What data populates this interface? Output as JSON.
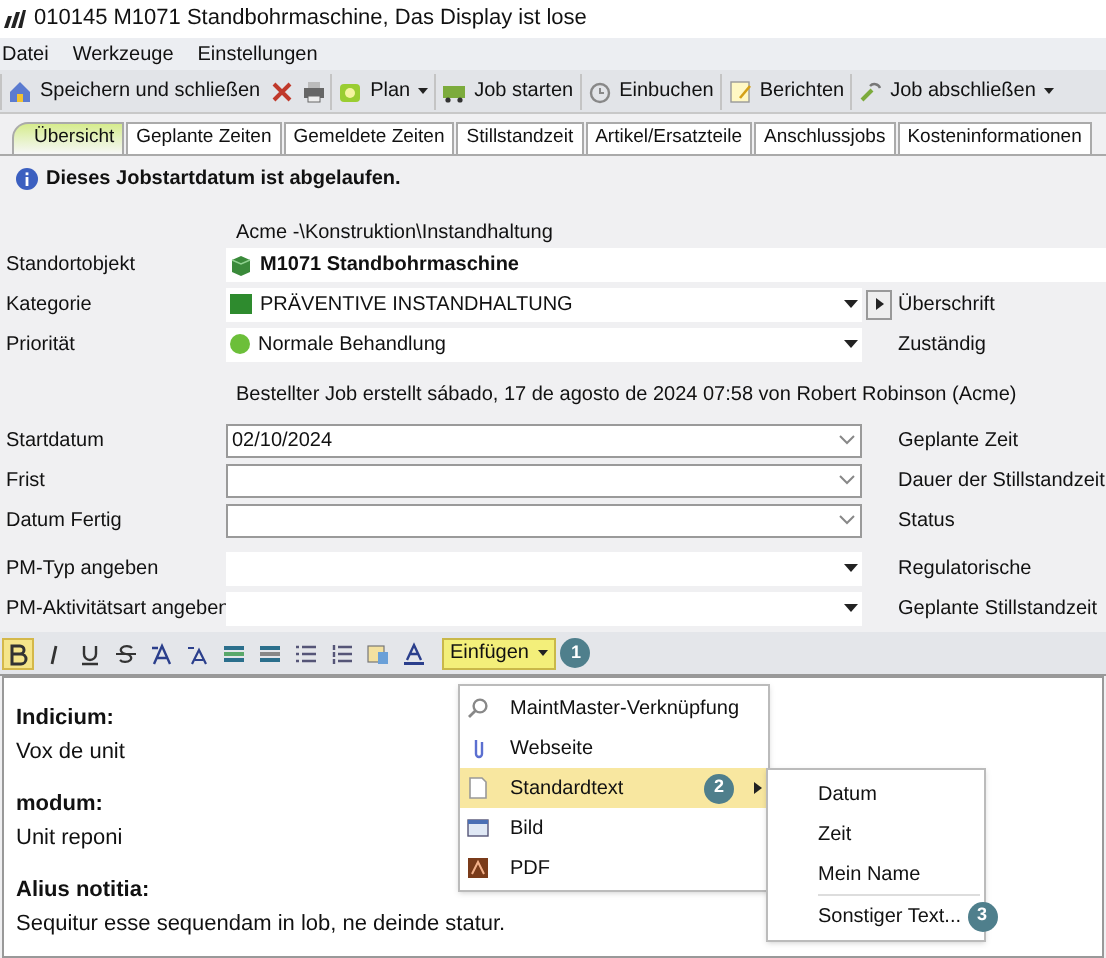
{
  "window": {
    "title": "010145 M1071  Standbohrmaschine, Das Display ist lose"
  },
  "menu_bar": [
    "Datei",
    "Werkzeuge",
    "Einstellungen"
  ],
  "toolbar": [
    {
      "kind": "button",
      "label": "Speichern und schließen"
    },
    {
      "kind": "icon"
    },
    {
      "kind": "icon"
    },
    {
      "kind": "dropdown",
      "label": "Plan"
    },
    {
      "kind": "button",
      "label": "Job starten"
    },
    {
      "kind": "button",
      "label": "Einbuchen"
    },
    {
      "kind": "button",
      "label": "Berichten"
    },
    {
      "kind": "dropdown",
      "label": "Job abschließen"
    }
  ],
  "tabs": [
    {
      "label": "Übersicht",
      "selected": true
    },
    {
      "label": "Geplante Zeiten",
      "selected": false
    },
    {
      "label": "Gemeldete Zeiten",
      "selected": false
    },
    {
      "label": "Stillstandzeit",
      "selected": false
    },
    {
      "label": "Artikel/Ersatzteile",
      "selected": false
    },
    {
      "label": "Anschlussjobs",
      "selected": false
    },
    {
      "label": "Kosteninformationen",
      "selected": false
    }
  ],
  "notice": "Dieses Jobstartdatum ist abgelaufen.",
  "form": {
    "path": "Acme -\\Konstruktion\\Instandhaltung",
    "rows_top": [
      {
        "label": "Standortobjekt",
        "kind": "object",
        "code": "M1071",
        "value": "Standbohrmaschine"
      },
      {
        "label": "Kategorie",
        "kind": "category",
        "value": "PRÄVENTIVE INSTANDHALTUNG",
        "right_label": "Überschrift"
      },
      {
        "label": "Priorität",
        "kind": "priority",
        "value": "Normale Behandlung",
        "right_label": "Zuständig"
      }
    ],
    "created": "Bestellter Job erstellt sábado, 17 de agosto de 2024 07:58 von Robert Robinson (Acme)",
    "rows_dates": [
      {
        "label": "Startdatum",
        "kind": "date",
        "value": "02/10/2024",
        "right_label": "Geplante Zeit"
      },
      {
        "label": "Frist",
        "kind": "date",
        "right_label": "Dauer der Stillstandzeit"
      },
      {
        "label": "Datum Fertig",
        "kind": "date",
        "right_label": "Status"
      }
    ],
    "rows_pm": [
      {
        "label": "PM-Typ angeben",
        "kind": "dropdown",
        "right_label": "Regulatorische"
      },
      {
        "label": "PM-Aktivitätsart angeben",
        "kind": "dropdown",
        "right_label": "Geplante Stillstandzeit"
      }
    ]
  },
  "format_toolbar": [
    {
      "kind": "bold",
      "selected": true
    },
    {
      "kind": "italic",
      "selected": false
    },
    {
      "kind": "underline",
      "selected": false
    },
    {
      "kind": "strike",
      "selected": false
    },
    {
      "kind": "grow",
      "selected": false
    },
    {
      "kind": "shrink",
      "selected": false
    },
    {
      "kind": "indent",
      "selected": false
    },
    {
      "kind": "outdent",
      "selected": false
    },
    {
      "kind": "bullets",
      "selected": false
    },
    {
      "kind": "numbers",
      "selected": false
    },
    {
      "kind": "image",
      "selected": false
    },
    {
      "kind": "color",
      "selected": false
    }
  ],
  "insert_button": {
    "label": "Einfügen",
    "badge": "1"
  },
  "insert_menu": [
    {
      "label": "MaintMaster-Verknüpfung",
      "selected": false,
      "submenu": false
    },
    {
      "label": "Webseite",
      "selected": false,
      "submenu": false
    },
    {
      "label": "Standardtext",
      "selected": true,
      "badge": "2",
      "submenu": true
    },
    {
      "label": "Bild",
      "selected": false,
      "submenu": false
    },
    {
      "label": "PDF",
      "selected": false,
      "submenu": false
    }
  ],
  "submenu": [
    {
      "kind": "item",
      "label": "Datum"
    },
    {
      "kind": "item",
      "label": "Zeit"
    },
    {
      "kind": "item",
      "label": "Mein Name"
    },
    {
      "kind": "separator"
    },
    {
      "kind": "item",
      "label": "Sonstiger Text...",
      "badge": "3"
    }
  ],
  "editor": [
    {
      "heading": "Indicium:",
      "text": "Vox de unit"
    },
    {
      "heading": "modum:",
      "text": "Unit reponi"
    },
    {
      "heading": "Alius notitia:",
      "text": "Sequitur esse sequendam in lob, ne deinde statur."
    }
  ]
}
